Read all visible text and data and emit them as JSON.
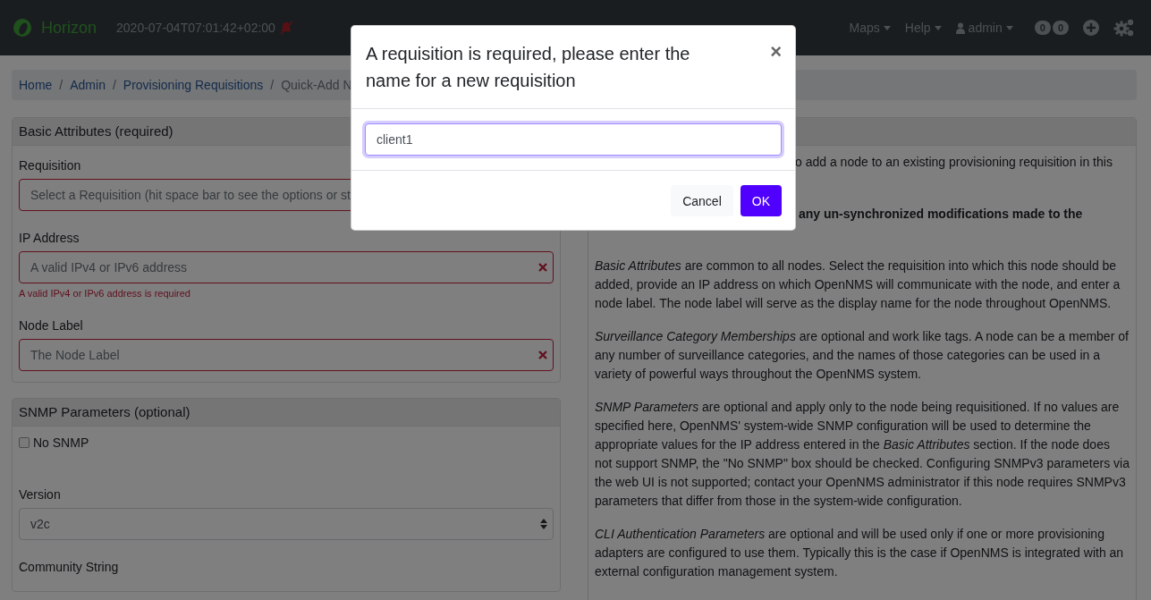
{
  "navbar": {
    "brand": "Horizon",
    "time": "2020-07-04T07:01:42+02:00",
    "notifications_muted": true,
    "menus": [
      {
        "label": "Maps",
        "dropdown": true
      },
      {
        "label": "Help",
        "dropdown": true
      }
    ],
    "user": "admin",
    "badges": [
      "0",
      "0"
    ]
  },
  "breadcrumb": [
    {
      "label": "Home",
      "link": true
    },
    {
      "label": "Admin",
      "link": true,
      "separator_before": "/"
    },
    {
      "label": "Provisioning Requisitions",
      "link": true,
      "separator_before": "/"
    },
    {
      "label": "Quick-Add N",
      "link": false,
      "separator_before": "/"
    }
  ],
  "basic": {
    "title": "Basic Attributes (required)",
    "fields": [
      {
        "label": "Requisition",
        "kind": "select",
        "placeholder": "Select a Requisition (hit space bar to see the options or st",
        "invalid": true,
        "clear_icon": false
      },
      {
        "label": "IP Address",
        "kind": "input",
        "placeholder": "A valid IPv4 or IPv6 address",
        "invalid": true,
        "clear_icon": true,
        "error": "A valid IPv4 or IPv6 address is required"
      },
      {
        "label": "Node Label",
        "kind": "input",
        "placeholder": "The Node Label",
        "invalid": true,
        "clear_icon": true
      }
    ]
  },
  "snmp": {
    "title": "SNMP Parameters (optional)",
    "no_snmp": {
      "label": "No SNMP",
      "checked": false
    },
    "version": {
      "label": "Version",
      "value": "v2c"
    },
    "community_label": "Community String"
  },
  "help": {
    "first_line": "o add a node to an existing provisioning requisition in this",
    "bold_line": "any un-synchronized modifications made to the",
    "paragraphs": [
      "*Basic Attributes* are common to all nodes. Select the requisition into which this node should be added, provide an IP address on which OpenNMS will communicate with the node, and enter a node label. The node label will serve as the display name for the node throughout OpenNMS.",
      "*Surveillance Category Memberships* are optional and work like tags. A node can be a member of any number of surveillance categories, and the names of those categories can be used in a variety of powerful ways throughout the OpenNMS system.",
      "*SNMP Parameters* are optional and apply only to the node being requisitioned. If no values are specified here, OpenNMS' system-wide SNMP configuration will be used to determine the appropriate values for the IP address entered in the *Basic Attributes* section. If the node does not support SNMP, the \"No SNMP\" box should be checked. Configuring SNMPv3 parameters via the web UI is not supported; contact your OpenNMS administrator if this node requires SNMPv3 parameters that differ from those in the system-wide configuration.",
      "*CLI Authentication Parameters* are optional and will be used only if one or more provisioning adapters are configured to use them. Typically this is the case if OpenNMS is integrated with an external configuration management system."
    ]
  },
  "modal": {
    "title": "A requisition is required, please enter the name for a new requisition",
    "close": "×",
    "value": "client1",
    "buttons": [
      {
        "label": "Cancel",
        "kind": "secondary"
      },
      {
        "label": "OK",
        "kind": "primary"
      }
    ]
  }
}
